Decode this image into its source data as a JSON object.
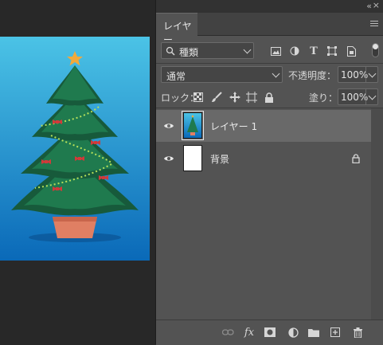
{
  "panel": {
    "tab_label": "レイヤー",
    "filter": {
      "value": "種類"
    },
    "blend_mode": {
      "value": "通常"
    },
    "opacity": {
      "label": "不透明度：",
      "value": "100%"
    },
    "lock": {
      "label": "ロック："
    },
    "fill": {
      "label": "塗り：",
      "value": "100%"
    },
    "layers": [
      {
        "name": "レイヤー 1",
        "selected": true,
        "visible": true
      },
      {
        "name": "背景",
        "selected": false,
        "visible": true,
        "locked": true
      }
    ]
  },
  "colors": {
    "panel_bg": "#535353",
    "selected_row": "#696969",
    "canvas_bg": "#282828",
    "sky_top": "#4bc3e6",
    "sky_bottom": "#0a69b8"
  },
  "icons": {
    "collapse": "double-chevron-icon",
    "close": "close-icon",
    "menu": "panel-menu-icon",
    "filter": [
      "search-icon",
      "image-filter-icon",
      "adjustment-filter-icon",
      "type-filter-icon",
      "shape-filter-icon",
      "smart-object-filter-icon",
      "filter-toggle-icon"
    ],
    "lock": [
      "lock-transparent-icon",
      "lock-image-icon",
      "lock-position-icon",
      "lock-artboard-icon",
      "lock-all-icon"
    ],
    "bottom": [
      "link-icon",
      "fx-icon",
      "mask-icon",
      "adjustment-icon",
      "folder-icon",
      "new-layer-icon",
      "trash-icon"
    ]
  }
}
